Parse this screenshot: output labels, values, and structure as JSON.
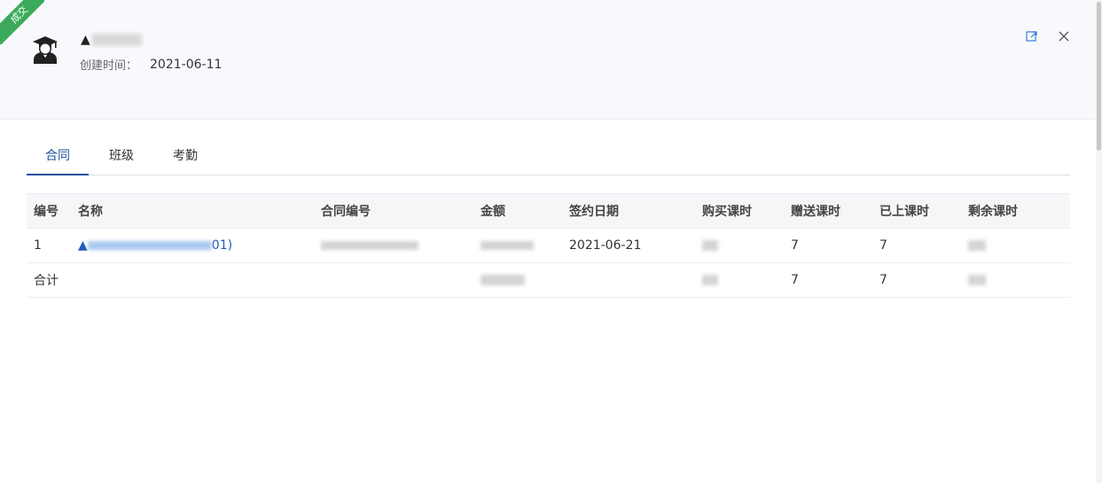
{
  "ribbon": {
    "label": "成交",
    "color": "#3aaa5a"
  },
  "header": {
    "avatar_icon": "student-graduate-icon",
    "name_prefix": "▲",
    "created_label": "创建时间：",
    "created_value": "2021-06-11",
    "actions": [
      {
        "name": "open-external-icon"
      },
      {
        "name": "close-icon"
      }
    ]
  },
  "tabs": [
    {
      "label": "合同",
      "active": true
    },
    {
      "label": "班级",
      "active": false
    },
    {
      "label": "考勤",
      "active": false
    }
  ],
  "table": {
    "columns": [
      "编号",
      "名称",
      "合同编号",
      "金额",
      "签约日期",
      "购买课时",
      "赠送课时",
      "已上课时",
      "剩余课时"
    ],
    "rows": [
      {
        "id": "1",
        "name_prefix": "▲",
        "name_suffix": "01)",
        "contract_no": "",
        "amount": "",
        "sign_date": "2021-06-21",
        "bought": "",
        "gift": "7",
        "used": "7",
        "remaining": ""
      }
    ],
    "total": {
      "label": "合计",
      "amount": "",
      "bought": "",
      "gift": "7",
      "used": "7",
      "remaining": ""
    }
  },
  "colors": {
    "accent": "#1f4e9c",
    "link": "#1f5bbd",
    "ribbon": "#3aaa5a"
  }
}
